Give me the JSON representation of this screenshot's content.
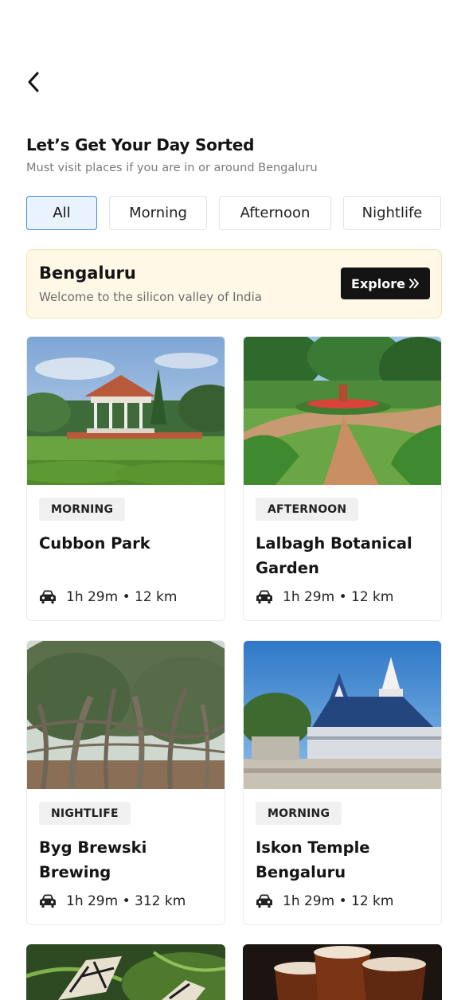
{
  "header": {
    "back_icon": "chevron-left-icon",
    "title": "Let’s Get Your Day Sorted",
    "subtitle": "Must visit places if you are in or around Bengaluru"
  },
  "filters": [
    {
      "label": "All",
      "active": true
    },
    {
      "label": "Morning",
      "active": false
    },
    {
      "label": "Afternoon",
      "active": false
    },
    {
      "label": "Nightlife",
      "active": false
    }
  ],
  "banner": {
    "title": "Bengaluru",
    "subtitle": "Welcome to the silicon valley of India",
    "button_label": "Explore",
    "button_icon": "double-chevron-right-icon"
  },
  "places": [
    {
      "tag": "MORNING",
      "name": "Cubbon Park",
      "distance": "1h 29m • 12 km",
      "image": "park-gazebo"
    },
    {
      "tag": "AFTERNOON",
      "name": "Lalbagh Botanical Garden",
      "distance": "1h 29m • 12 km",
      "image": "garden-path"
    },
    {
      "tag": "NIGHTLIFE",
      "name": "Byg Brewski Brewing",
      "distance": "1h 29m • 312 km",
      "image": "banyan-tree"
    },
    {
      "tag": "MORNING",
      "name": "Iskon Temple Bengaluru",
      "distance": "1h 29m • 12 km",
      "image": "temple"
    }
  ],
  "colors": {
    "accent": "#3a8ee6",
    "chip_active_bg": "#eaf3fd",
    "banner_bg": "#fff8e6",
    "button_bg": "#141414"
  }
}
